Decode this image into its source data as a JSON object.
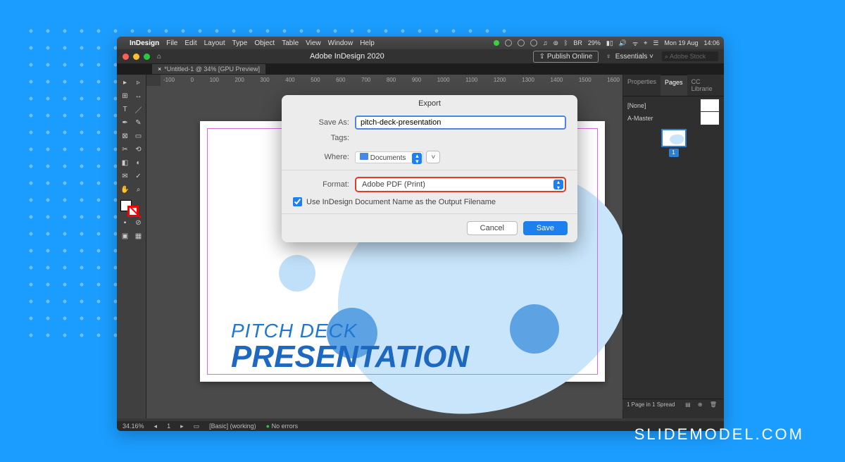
{
  "menubar": {
    "app": "InDesign",
    "items": [
      "File",
      "Edit",
      "Layout",
      "Type",
      "Object",
      "Table",
      "View",
      "Window",
      "Help"
    ],
    "right": {
      "battery": "29%",
      "lang": "BR",
      "day": "Mon 19 Aug",
      "time": "14:06"
    }
  },
  "window": {
    "title": "Adobe InDesign 2020",
    "publish": "Publish Online",
    "workspace": "Essentials",
    "search_placeholder": "Adobe Stock"
  },
  "tab": {
    "label": "*Untitled-1 @ 34% [GPU Preview]"
  },
  "ruler": [
    "-100",
    "0",
    "100",
    "200",
    "300",
    "400",
    "500",
    "600",
    "700",
    "800",
    "900",
    "1000",
    "1100",
    "1200",
    "1300",
    "1400",
    "1500",
    "1600"
  ],
  "page": {
    "title": "PITCH DECK",
    "subtitle": "PRESENTATION"
  },
  "panels": {
    "tabs": [
      "Properties",
      "Pages",
      "CC Librarie"
    ],
    "rows": [
      "[None]",
      "A-Master"
    ],
    "page_number": "1",
    "footer": "1 Page in 1 Spread"
  },
  "status": {
    "zoom": "34.16%",
    "working": "[Basic] (working)",
    "errors": "No errors"
  },
  "dialog": {
    "title": "Export",
    "saveas_label": "Save As:",
    "filename": "pitch-deck-presentation",
    "tags_label": "Tags:",
    "where_label": "Where:",
    "where_value": "Documents",
    "format_label": "Format:",
    "format_value": "Adobe PDF (Print)",
    "checkbox": "Use InDesign Document Name as the Output Filename",
    "cancel": "Cancel",
    "save": "Save"
  },
  "watermark": "SLIDEMODEL.COM"
}
